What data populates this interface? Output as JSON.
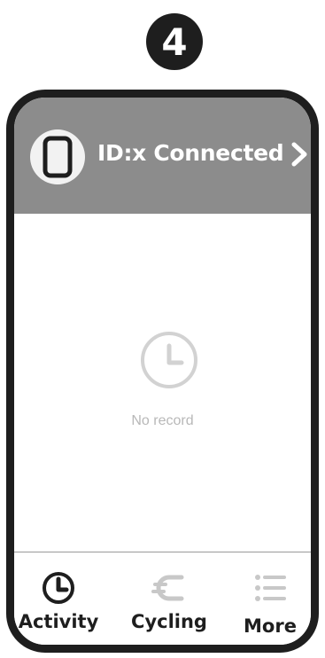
{
  "step_number": "4",
  "header": {
    "connection_text": "ID:x Connected",
    "device_icon": "phone-icon",
    "chevron_icon": "chevron-right-icon",
    "background_color": "#8c8c8c"
  },
  "empty_state": {
    "icon": "clock-icon",
    "text": "No record"
  },
  "tabs": [
    {
      "label": "Activity",
      "icon": "clock-icon",
      "active": true
    },
    {
      "label": "Cycling",
      "icon": "cycling-icon",
      "active": false
    },
    {
      "label": "More",
      "icon": "list-icon",
      "active": false
    }
  ],
  "colors": {
    "frame": "#1e1e1e",
    "inactive_icon": "#c8c8c8",
    "muted_text": "#b8b8b8"
  }
}
